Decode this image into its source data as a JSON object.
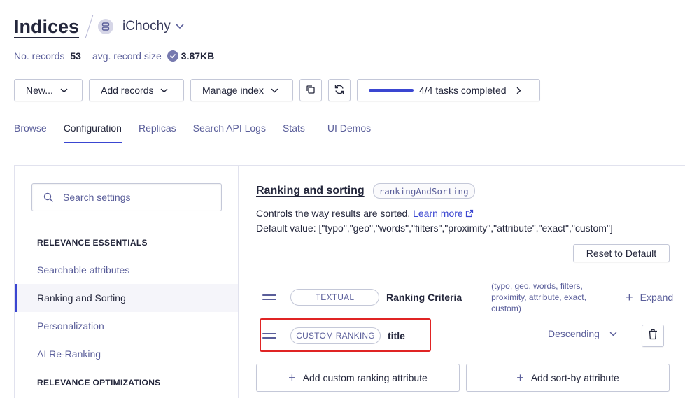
{
  "header": {
    "title": "Indices",
    "app_name": "iChochy"
  },
  "stats": {
    "records_label": "No. records",
    "records_value": "53",
    "size_label": "avg. record size",
    "size_value": "3.87KB"
  },
  "toolbar": {
    "new_label": "New...",
    "add_records_label": "Add records",
    "manage_index_label": "Manage index",
    "tasks_label": "4/4 tasks completed",
    "tasks_progress": 1.0
  },
  "tabs": [
    {
      "label": "Browse",
      "active": false
    },
    {
      "label": "Configuration",
      "active": true
    },
    {
      "label": "Replicas",
      "active": false
    },
    {
      "label": "Search API Logs",
      "active": false
    },
    {
      "label": "Stats",
      "active": false
    },
    {
      "label": "UI Demos",
      "active": false
    }
  ],
  "sidebar": {
    "search_placeholder": "Search settings",
    "heading_essentials": "RELEVANCE ESSENTIALS",
    "items": [
      {
        "label": "Searchable attributes"
      },
      {
        "label": "Ranking and Sorting"
      },
      {
        "label": "Personalization"
      },
      {
        "label": "AI Re-Ranking"
      }
    ],
    "heading_optimizations": "RELEVANCE OPTIMIZATIONS"
  },
  "section": {
    "title": "Ranking and sorting",
    "code": "rankingAndSorting",
    "description": "Controls the way results are sorted.",
    "learn_more": "Learn more",
    "default_value": "Default value: [\"typo\",\"geo\",\"words\",\"filters\",\"proximity\",\"attribute\",\"exact\",\"custom\"]",
    "reset_label": "Reset to Default"
  },
  "criteria": [
    {
      "pill": "TEXTUAL",
      "name": "Ranking Criteria",
      "sub": "(typo, geo, words, filters, proximity, attribute, exact, custom)",
      "action": "Expand"
    },
    {
      "pill": "CUSTOM RANKING",
      "name": "title",
      "order": "Descending"
    }
  ],
  "actions": {
    "add_custom_ranking": "Add custom ranking attribute",
    "add_sort_by": "Add sort-by attribute"
  },
  "colors": {
    "accent": "#3a46d1",
    "highlight": "#e02424",
    "text": "#23263b",
    "muted": "#5a5e9a"
  }
}
